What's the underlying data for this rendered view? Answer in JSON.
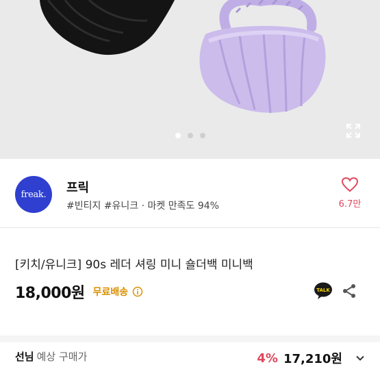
{
  "gallery": {
    "page_count": 3,
    "active_page": 1,
    "colors": {
      "bag1": "#111111",
      "bag2": "#c9b8ea",
      "background": "#eaeaea"
    }
  },
  "shop": {
    "logo_text": "freak.",
    "logo_color": "#2f3fd0",
    "name": "프릭",
    "meta": "#빈티지 #유니크 · 마켓 만족도 94%",
    "like_count": "6.7만"
  },
  "product": {
    "title": "[키치/유니크] 90s 레더 셔링 미니 숄더백 미니백",
    "price": "18,000원",
    "shipping": "무료배송",
    "talk_label": "TALK"
  },
  "expected": {
    "grade": "선님",
    "label": "예상 구매가",
    "discount": "4%",
    "price": "17,210원"
  },
  "colors": {
    "accent": "#e0485b",
    "shipping": "#d99000"
  }
}
